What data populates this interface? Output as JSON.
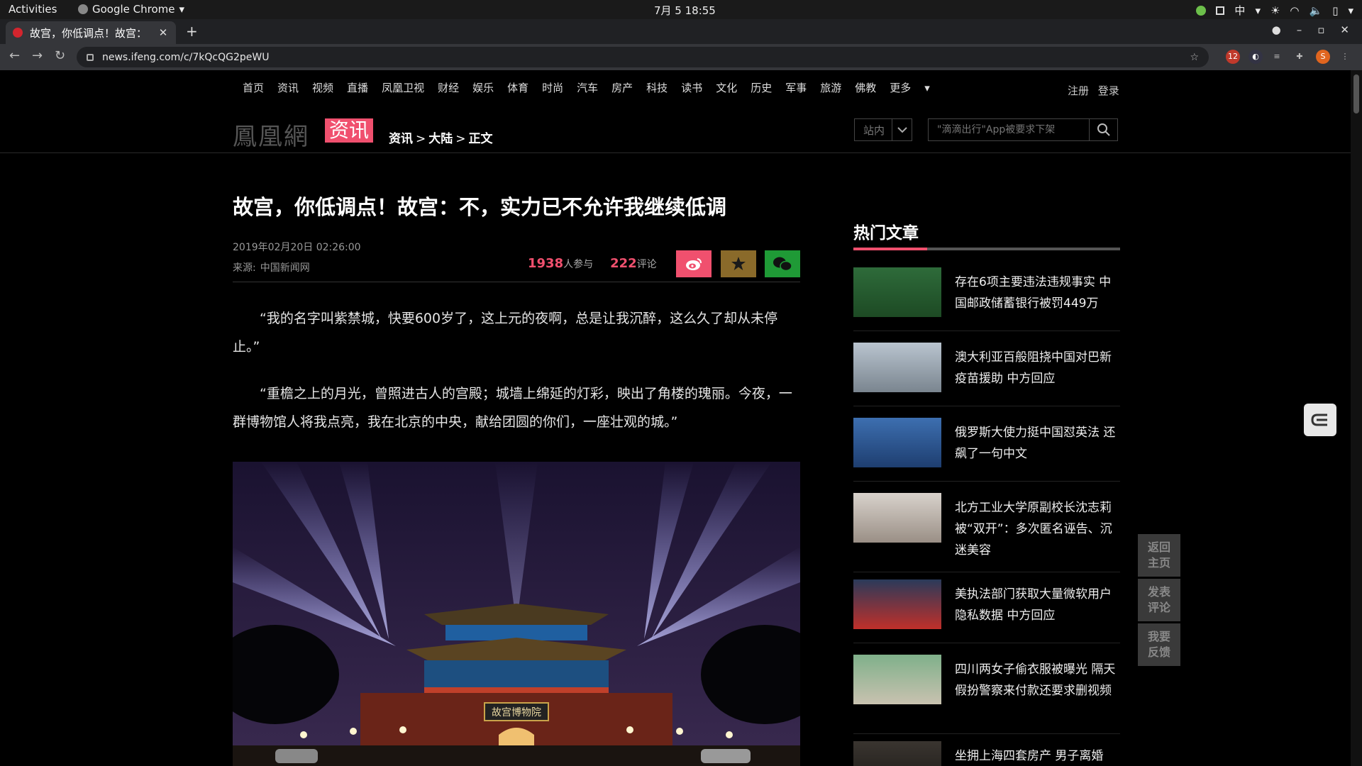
{
  "system": {
    "activities": "Activities",
    "app_name": "Google Chrome",
    "clock": "7月 5  18:55",
    "input_method": "中"
  },
  "browser": {
    "tab_title": "故宫，你低调点！故宫：",
    "url": "news.ifeng.com/c/7kQcQG2peWU",
    "ext_badge": "12",
    "profile_initial": "S"
  },
  "site": {
    "nav": [
      "首页",
      "资讯",
      "视频",
      "直播",
      "凤凰卫视",
      "财经",
      "娱乐",
      "体育",
      "时尚",
      "汽车",
      "房产",
      "科技",
      "读书",
      "文化",
      "历史",
      "军事",
      "旅游",
      "佛教",
      "更多"
    ],
    "register": "注册",
    "login": "登录",
    "logo_text": "鳳凰網",
    "logo_badge": "资讯",
    "breadcrumb": [
      "资讯",
      "大陆",
      "正文"
    ],
    "site_select": "站内",
    "search_placeholder": "\"滴滴出行\"App被要求下架"
  },
  "article": {
    "title": "故宫，你低调点！故宫：不，实力已不允许我继续低调",
    "date": "2019年02月20日 02:26:00",
    "source_label": "来源:",
    "source_name": "中国新闻网",
    "participants": "1938",
    "participants_label": "人参与",
    "comments": "222",
    "comments_label": "评论",
    "paragraphs": [
      "“我的名字叫紫禁城，快要600岁了，这上元的夜啊，总是让我沉醉，这么久了却从未停止。”",
      "“重檐之上的月光，曾照进古人的宫殿；城墙上绵延的灯彩，映出了角楼的瑰丽。今夜，一群博物馆人将我点亮，我在北京的中央，献给团圆的你们，一座壮观的城。”"
    ],
    "image_caption_text": "故宫博物院"
  },
  "hot": {
    "title": "热门文章",
    "items": [
      {
        "text": "存在6项主要违法违规事实 中国邮政储蓄银行被罚449万"
      },
      {
        "text": "澳大利亚百般阻挠中国对巴新疫苗援助 中方回应"
      },
      {
        "text": "俄罗斯大使力挺中国怼英法 还飙了一句中文"
      },
      {
        "text": "北方工业大学原副校长沈志莉被“双开”：多次匿名诬告、沉迷美容"
      },
      {
        "text": "美执法部门获取大量微软用户隐私数据 中方回应"
      },
      {
        "text": "四川两女子偷衣服被曝光 隔天假扮警察来付款还要求删视频"
      },
      {
        "text": "坐拥上海四套房产 男子离婚"
      }
    ]
  },
  "side_buttons": [
    "返回主页",
    "发表评论",
    "我要反馈"
  ],
  "colors": {
    "accent": "#f0506e",
    "weibo": "#f0506e",
    "fav": "#8a6a2a",
    "wechat": "#1f9a36"
  }
}
